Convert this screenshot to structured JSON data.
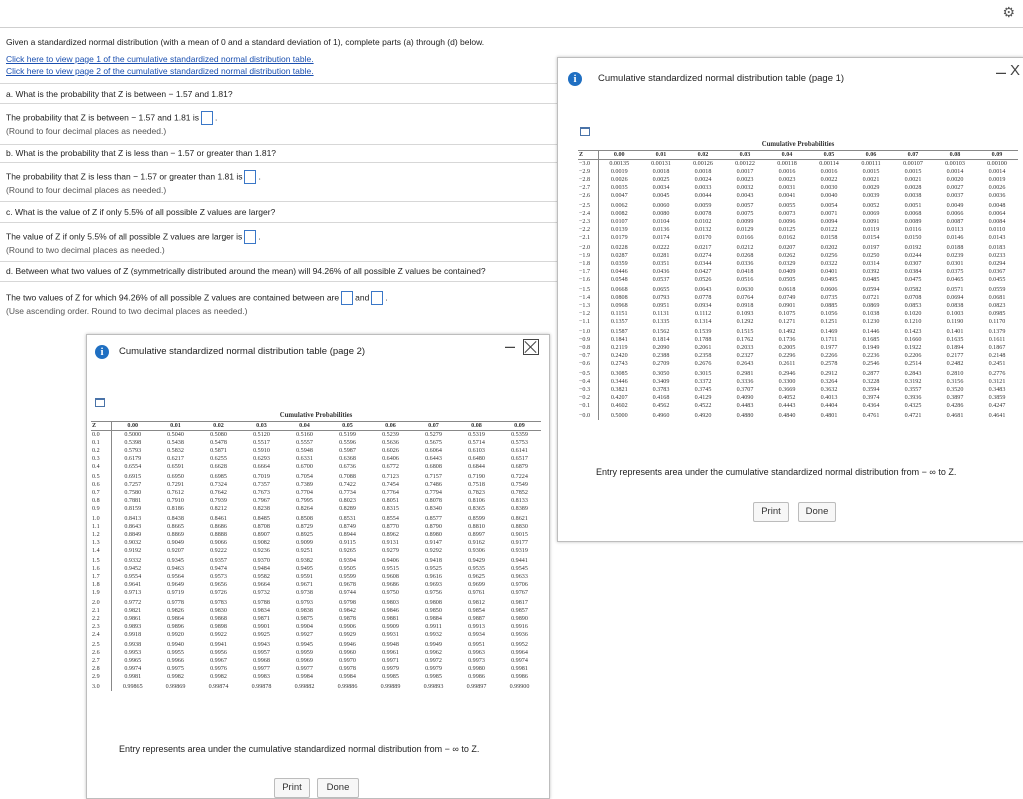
{
  "settings_icon": "gear-icon",
  "intro": "Given a standardized normal distribution (with a mean of 0 and a standard deviation of 1), complete parts (a) through (d) below.",
  "links": {
    "page1": "Click here to view page 1 of the cumulative standardized normal distribution table.",
    "page2": "Click here to view page 2 of the cumulative standardized normal distribution table."
  },
  "part_a": {
    "question": "a. What is the probability that Z is between − 1.57 and 1.81?",
    "prompt": "The probability that Z is between − 1.57 and 1.81 is",
    "hint": "(Round to four decimal places as needed.)",
    "answer": ""
  },
  "part_b": {
    "question": "b. What is the probability that Z is less than − 1.57 or greater than 1.81?",
    "prompt": "The probability that Z is less than − 1.57 or greater than 1.81 is",
    "hint": "(Round to four decimal places as needed.)",
    "answer": ""
  },
  "part_c": {
    "question": "c. What is the value of Z if only 5.5% of all possible Z values are larger?",
    "prompt": "The value of Z if only 5.5% of all possible Z values are larger is",
    "hint": "(Round to two decimal places as needed.)",
    "answer": ""
  },
  "part_d": {
    "question": "d. Between what two values of Z (symmetrically distributed around the mean) will 94.26% of all possible Z values be contained?",
    "prompt": "The two values of Z for which 94.26% of all possible Z values are contained between are",
    "and": "and",
    "hint": "(Use ascending order. Round to two decimal places as needed.)",
    "answer1": "",
    "answer2": ""
  },
  "table_page1": {
    "title": "Cumulative standardized normal distribution table (page 1)",
    "minimize": "–",
    "close": "X",
    "caption": "Cumulative Probabilities",
    "headers": [
      "Z",
      "0.00",
      "0.01",
      "0.02",
      "0.03",
      "0.04",
      "0.05",
      "0.06",
      "0.07",
      "0.08",
      "0.09"
    ],
    "rows": [
      [
        "−3.0",
        "0.00135",
        "0.00131",
        "0.00126",
        "0.00122",
        "0.00118",
        "0.00114",
        "0.00111",
        "0.00107",
        "0.00103",
        "0.00100"
      ],
      [
        "−2.9",
        "0.0019",
        "0.0018",
        "0.0018",
        "0.0017",
        "0.0016",
        "0.0016",
        "0.0015",
        "0.0015",
        "0.0014",
        "0.0014"
      ],
      [
        "−2.8",
        "0.0026",
        "0.0025",
        "0.0024",
        "0.0023",
        "0.0023",
        "0.0022",
        "0.0021",
        "0.0021",
        "0.0020",
        "0.0019"
      ],
      [
        "−2.7",
        "0.0035",
        "0.0034",
        "0.0033",
        "0.0032",
        "0.0031",
        "0.0030",
        "0.0029",
        "0.0028",
        "0.0027",
        "0.0026"
      ],
      [
        "−2.6",
        "0.0047",
        "0.0045",
        "0.0044",
        "0.0043",
        "0.0041",
        "0.0040",
        "0.0039",
        "0.0038",
        "0.0037",
        "0.0036"
      ],
      [
        "−2.5",
        "0.0062",
        "0.0060",
        "0.0059",
        "0.0057",
        "0.0055",
        "0.0054",
        "0.0052",
        "0.0051",
        "0.0049",
        "0.0048"
      ],
      [
        "−2.4",
        "0.0082",
        "0.0080",
        "0.0078",
        "0.0075",
        "0.0073",
        "0.0071",
        "0.0069",
        "0.0068",
        "0.0066",
        "0.0064"
      ],
      [
        "−2.3",
        "0.0107",
        "0.0104",
        "0.0102",
        "0.0099",
        "0.0096",
        "0.0094",
        "0.0091",
        "0.0089",
        "0.0087",
        "0.0084"
      ],
      [
        "−2.2",
        "0.0139",
        "0.0136",
        "0.0132",
        "0.0129",
        "0.0125",
        "0.0122",
        "0.0119",
        "0.0116",
        "0.0113",
        "0.0110"
      ],
      [
        "−2.1",
        "0.0179",
        "0.0174",
        "0.0170",
        "0.0166",
        "0.0162",
        "0.0158",
        "0.0154",
        "0.0150",
        "0.0146",
        "0.0143"
      ],
      [
        "−2.0",
        "0.0228",
        "0.0222",
        "0.0217",
        "0.0212",
        "0.0207",
        "0.0202",
        "0.0197",
        "0.0192",
        "0.0188",
        "0.0183"
      ],
      [
        "−1.9",
        "0.0287",
        "0.0281",
        "0.0274",
        "0.0268",
        "0.0262",
        "0.0256",
        "0.0250",
        "0.0244",
        "0.0239",
        "0.0233"
      ],
      [
        "−1.8",
        "0.0359",
        "0.0351",
        "0.0344",
        "0.0336",
        "0.0329",
        "0.0322",
        "0.0314",
        "0.0307",
        "0.0301",
        "0.0294"
      ],
      [
        "−1.7",
        "0.0446",
        "0.0436",
        "0.0427",
        "0.0418",
        "0.0409",
        "0.0401",
        "0.0392",
        "0.0384",
        "0.0375",
        "0.0367"
      ],
      [
        "−1.6",
        "0.0548",
        "0.0537",
        "0.0526",
        "0.0516",
        "0.0505",
        "0.0495",
        "0.0485",
        "0.0475",
        "0.0465",
        "0.0455"
      ],
      [
        "−1.5",
        "0.0668",
        "0.0655",
        "0.0643",
        "0.0630",
        "0.0618",
        "0.0606",
        "0.0594",
        "0.0582",
        "0.0571",
        "0.0559"
      ],
      [
        "−1.4",
        "0.0808",
        "0.0793",
        "0.0778",
        "0.0764",
        "0.0749",
        "0.0735",
        "0.0721",
        "0.0708",
        "0.0694",
        "0.0681"
      ],
      [
        "−1.3",
        "0.0968",
        "0.0951",
        "0.0934",
        "0.0918",
        "0.0901",
        "0.0885",
        "0.0869",
        "0.0853",
        "0.0838",
        "0.0823"
      ],
      [
        "−1.2",
        "0.1151",
        "0.1131",
        "0.1112",
        "0.1093",
        "0.1075",
        "0.1056",
        "0.1038",
        "0.1020",
        "0.1003",
        "0.0985"
      ],
      [
        "−1.1",
        "0.1357",
        "0.1335",
        "0.1314",
        "0.1292",
        "0.1271",
        "0.1251",
        "0.1230",
        "0.1210",
        "0.1190",
        "0.1170"
      ],
      [
        "−1.0",
        "0.1587",
        "0.1562",
        "0.1539",
        "0.1515",
        "0.1492",
        "0.1469",
        "0.1446",
        "0.1423",
        "0.1401",
        "0.1379"
      ],
      [
        "−0.9",
        "0.1841",
        "0.1814",
        "0.1788",
        "0.1762",
        "0.1736",
        "0.1711",
        "0.1685",
        "0.1660",
        "0.1635",
        "0.1611"
      ],
      [
        "−0.8",
        "0.2119",
        "0.2090",
        "0.2061",
        "0.2033",
        "0.2005",
        "0.1977",
        "0.1949",
        "0.1922",
        "0.1894",
        "0.1867"
      ],
      [
        "−0.7",
        "0.2420",
        "0.2388",
        "0.2358",
        "0.2327",
        "0.2296",
        "0.2266",
        "0.2236",
        "0.2206",
        "0.2177",
        "0.2148"
      ],
      [
        "−0.6",
        "0.2743",
        "0.2709",
        "0.2676",
        "0.2643",
        "0.2611",
        "0.2578",
        "0.2546",
        "0.2514",
        "0.2482",
        "0.2451"
      ],
      [
        "−0.5",
        "0.3085",
        "0.3050",
        "0.3015",
        "0.2981",
        "0.2946",
        "0.2912",
        "0.2877",
        "0.2843",
        "0.2810",
        "0.2776"
      ],
      [
        "−0.4",
        "0.3446",
        "0.3409",
        "0.3372",
        "0.3336",
        "0.3300",
        "0.3264",
        "0.3228",
        "0.3192",
        "0.3156",
        "0.3121"
      ],
      [
        "−0.3",
        "0.3821",
        "0.3783",
        "0.3745",
        "0.3707",
        "0.3669",
        "0.3632",
        "0.3594",
        "0.3557",
        "0.3520",
        "0.3483"
      ],
      [
        "−0.2",
        "0.4207",
        "0.4168",
        "0.4129",
        "0.4090",
        "0.4052",
        "0.4013",
        "0.3974",
        "0.3936",
        "0.3897",
        "0.3859"
      ],
      [
        "−0.1",
        "0.4602",
        "0.4562",
        "0.4522",
        "0.4483",
        "0.4443",
        "0.4404",
        "0.4364",
        "0.4325",
        "0.4286",
        "0.4247"
      ],
      [
        "−0.0",
        "0.5000",
        "0.4960",
        "0.4920",
        "0.4880",
        "0.4840",
        "0.4801",
        "0.4761",
        "0.4721",
        "0.4681",
        "0.4641"
      ]
    ],
    "note": "Entry represents area under the cumulative standardized normal distribution from − ∞ to Z.",
    "print": "Print",
    "done": "Done"
  },
  "table_page2": {
    "title": "Cumulative standardized normal distribution table (page 2)",
    "minimize": "–",
    "caption": "Cumulative Probabilities",
    "headers": [
      "Z",
      "0.00",
      "0.01",
      "0.02",
      "0.03",
      "0.04",
      "0.05",
      "0.06",
      "0.07",
      "0.08",
      "0.09"
    ],
    "rows": [
      [
        "0.0",
        "0.5000",
        "0.5040",
        "0.5080",
        "0.5120",
        "0.5160",
        "0.5199",
        "0.5239",
        "0.5279",
        "0.5319",
        "0.5359"
      ],
      [
        "0.1",
        "0.5398",
        "0.5438",
        "0.5478",
        "0.5517",
        "0.5557",
        "0.5596",
        "0.5636",
        "0.5675",
        "0.5714",
        "0.5753"
      ],
      [
        "0.2",
        "0.5793",
        "0.5832",
        "0.5871",
        "0.5910",
        "0.5948",
        "0.5987",
        "0.6026",
        "0.6064",
        "0.6103",
        "0.6141"
      ],
      [
        "0.3",
        "0.6179",
        "0.6217",
        "0.6255",
        "0.6293",
        "0.6331",
        "0.6368",
        "0.6406",
        "0.6443",
        "0.6480",
        "0.6517"
      ],
      [
        "0.4",
        "0.6554",
        "0.6591",
        "0.6628",
        "0.6664",
        "0.6700",
        "0.6736",
        "0.6772",
        "0.6808",
        "0.6844",
        "0.6879"
      ],
      [
        "0.5",
        "0.6915",
        "0.6950",
        "0.6985",
        "0.7019",
        "0.7054",
        "0.7088",
        "0.7123",
        "0.7157",
        "0.7190",
        "0.7224"
      ],
      [
        "0.6",
        "0.7257",
        "0.7291",
        "0.7324",
        "0.7357",
        "0.7389",
        "0.7422",
        "0.7454",
        "0.7486",
        "0.7518",
        "0.7549"
      ],
      [
        "0.7",
        "0.7580",
        "0.7612",
        "0.7642",
        "0.7673",
        "0.7704",
        "0.7734",
        "0.7764",
        "0.7794",
        "0.7823",
        "0.7852"
      ],
      [
        "0.8",
        "0.7881",
        "0.7910",
        "0.7939",
        "0.7967",
        "0.7995",
        "0.8023",
        "0.8051",
        "0.8078",
        "0.8106",
        "0.8133"
      ],
      [
        "0.9",
        "0.8159",
        "0.8186",
        "0.8212",
        "0.8238",
        "0.8264",
        "0.8289",
        "0.8315",
        "0.8340",
        "0.8365",
        "0.8389"
      ],
      [
        "1.0",
        "0.8413",
        "0.8438",
        "0.8461",
        "0.8485",
        "0.8508",
        "0.8531",
        "0.8554",
        "0.8577",
        "0.8599",
        "0.8621"
      ],
      [
        "1.1",
        "0.8643",
        "0.8665",
        "0.8686",
        "0.8708",
        "0.8729",
        "0.8749",
        "0.8770",
        "0.8790",
        "0.8810",
        "0.8830"
      ],
      [
        "1.2",
        "0.8849",
        "0.8869",
        "0.8888",
        "0.8907",
        "0.8925",
        "0.8944",
        "0.8962",
        "0.8980",
        "0.8997",
        "0.9015"
      ],
      [
        "1.3",
        "0.9032",
        "0.9049",
        "0.9066",
        "0.9082",
        "0.9099",
        "0.9115",
        "0.9131",
        "0.9147",
        "0.9162",
        "0.9177"
      ],
      [
        "1.4",
        "0.9192",
        "0.9207",
        "0.9222",
        "0.9236",
        "0.9251",
        "0.9265",
        "0.9279",
        "0.9292",
        "0.9306",
        "0.9319"
      ],
      [
        "1.5",
        "0.9332",
        "0.9345",
        "0.9357",
        "0.9370",
        "0.9382",
        "0.9394",
        "0.9406",
        "0.9418",
        "0.9429",
        "0.9441"
      ],
      [
        "1.6",
        "0.9452",
        "0.9463",
        "0.9474",
        "0.9484",
        "0.9495",
        "0.9505",
        "0.9515",
        "0.9525",
        "0.9535",
        "0.9545"
      ],
      [
        "1.7",
        "0.9554",
        "0.9564",
        "0.9573",
        "0.9582",
        "0.9591",
        "0.9599",
        "0.9608",
        "0.9616",
        "0.9625",
        "0.9633"
      ],
      [
        "1.8",
        "0.9641",
        "0.9649",
        "0.9656",
        "0.9664",
        "0.9671",
        "0.9678",
        "0.9686",
        "0.9693",
        "0.9699",
        "0.9706"
      ],
      [
        "1.9",
        "0.9713",
        "0.9719",
        "0.9726",
        "0.9732",
        "0.9738",
        "0.9744",
        "0.9750",
        "0.9756",
        "0.9761",
        "0.9767"
      ],
      [
        "2.0",
        "0.9772",
        "0.9778",
        "0.9783",
        "0.9788",
        "0.9793",
        "0.9798",
        "0.9803",
        "0.9808",
        "0.9812",
        "0.9817"
      ],
      [
        "2.1",
        "0.9821",
        "0.9826",
        "0.9830",
        "0.9834",
        "0.9838",
        "0.9842",
        "0.9846",
        "0.9850",
        "0.9854",
        "0.9857"
      ],
      [
        "2.2",
        "0.9861",
        "0.9864",
        "0.9868",
        "0.9871",
        "0.9875",
        "0.9878",
        "0.9881",
        "0.9884",
        "0.9887",
        "0.9890"
      ],
      [
        "2.3",
        "0.9893",
        "0.9896",
        "0.9898",
        "0.9901",
        "0.9904",
        "0.9906",
        "0.9909",
        "0.9911",
        "0.9913",
        "0.9916"
      ],
      [
        "2.4",
        "0.9918",
        "0.9920",
        "0.9922",
        "0.9925",
        "0.9927",
        "0.9929",
        "0.9931",
        "0.9932",
        "0.9934",
        "0.9936"
      ],
      [
        "2.5",
        "0.9938",
        "0.9940",
        "0.9941",
        "0.9943",
        "0.9945",
        "0.9946",
        "0.9948",
        "0.9949",
        "0.9951",
        "0.9952"
      ],
      [
        "2.6",
        "0.9953",
        "0.9955",
        "0.9956",
        "0.9957",
        "0.9959",
        "0.9960",
        "0.9961",
        "0.9962",
        "0.9963",
        "0.9964"
      ],
      [
        "2.7",
        "0.9965",
        "0.9966",
        "0.9967",
        "0.9968",
        "0.9969",
        "0.9970",
        "0.9971",
        "0.9972",
        "0.9973",
        "0.9974"
      ],
      [
        "2.8",
        "0.9974",
        "0.9975",
        "0.9976",
        "0.9977",
        "0.9977",
        "0.9978",
        "0.9979",
        "0.9979",
        "0.9980",
        "0.9981"
      ],
      [
        "2.9",
        "0.9981",
        "0.9982",
        "0.9982",
        "0.9983",
        "0.9984",
        "0.9984",
        "0.9985",
        "0.9985",
        "0.9986",
        "0.9986"
      ],
      [
        "3.0",
        "0.99865",
        "0.99869",
        "0.99874",
        "0.99878",
        "0.99882",
        "0.99886",
        "0.99889",
        "0.99893",
        "0.99897",
        "0.99900"
      ]
    ],
    "note": "Entry represents area under the cumulative standardized normal distribution from − ∞ to Z.",
    "print": "Print",
    "done": "Done"
  }
}
